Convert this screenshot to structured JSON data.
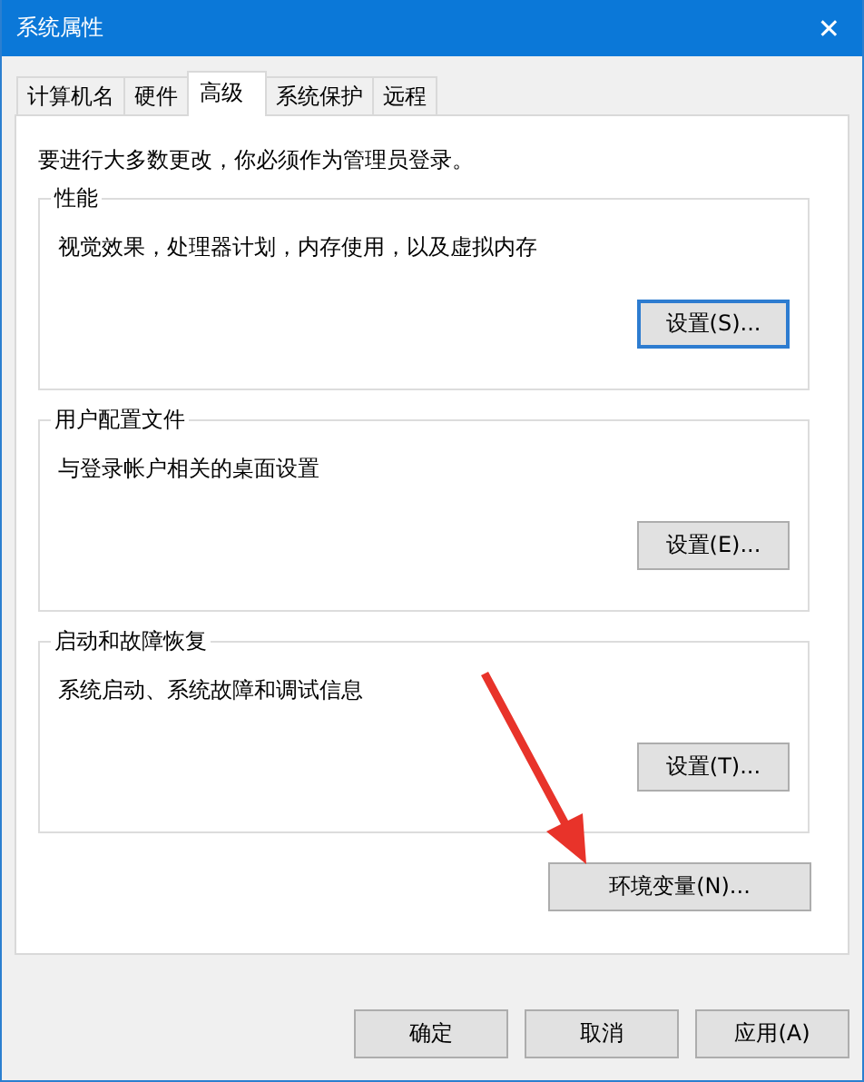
{
  "window": {
    "title": "系统属性",
    "close": "✕"
  },
  "tabs": [
    {
      "label": "计算机名",
      "selected": false
    },
    {
      "label": "硬件",
      "selected": false
    },
    {
      "label": "高级",
      "selected": true
    },
    {
      "label": "系统保护",
      "selected": false
    },
    {
      "label": "远程",
      "selected": false
    }
  ],
  "notice": "要进行大多数更改，你必须作为管理员登录。",
  "groups": [
    {
      "title": "性能",
      "description": "视觉效果，处理器计划，内存使用，以及虚拟内存",
      "button": {
        "label": "设置(S)...",
        "focused": true
      }
    },
    {
      "title": "用户配置文件",
      "description": "与登录帐户相关的桌面设置",
      "button": {
        "label": "设置(E)...",
        "focused": false
      }
    },
    {
      "title": "启动和故障恢复",
      "description": "系统启动、系统故障和调试信息",
      "button": {
        "label": "设置(T)...",
        "focused": false
      }
    }
  ],
  "env_button": "环境变量(N)...",
  "dialog_buttons": [
    "确定",
    "取消",
    "应用(A)"
  ]
}
